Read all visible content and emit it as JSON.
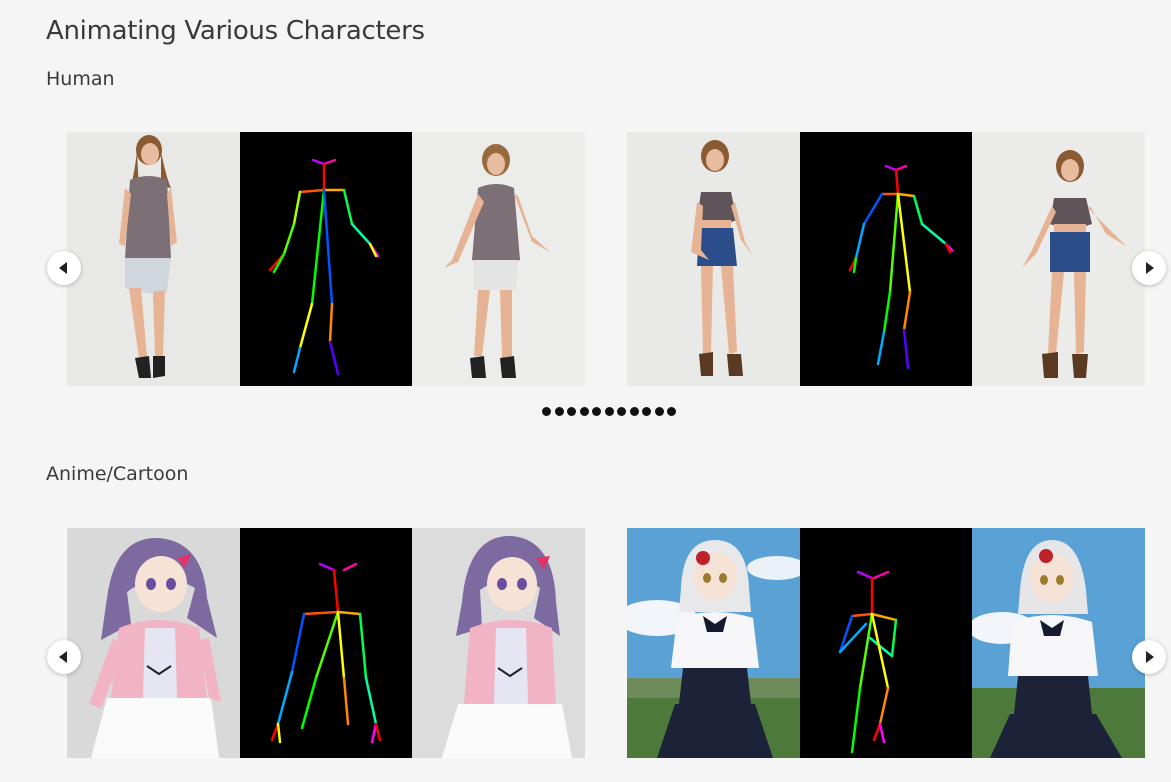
{
  "page": {
    "title": "Animating Various Characters"
  },
  "sections": {
    "human": {
      "title": "Human",
      "slides": [
        {
          "panels": [
            "reference-image",
            "pose-sequence",
            "generated-video"
          ]
        },
        {
          "panels": [
            "reference-image",
            "pose-sequence",
            "generated-video"
          ]
        }
      ],
      "pagination_count": 11
    },
    "anime": {
      "title": "Anime/Cartoon",
      "slides": [
        {
          "panels": [
            "reference-image",
            "pose-sequence",
            "generated-video"
          ]
        },
        {
          "panels": [
            "reference-image",
            "pose-sequence",
            "generated-video"
          ]
        }
      ]
    }
  },
  "icons": {
    "prev": "chevron-left-icon",
    "next": "chevron-right-icon"
  },
  "colors": {
    "background": "#f5f5f5",
    "pose_background": "#000000",
    "dot": "#111111"
  }
}
